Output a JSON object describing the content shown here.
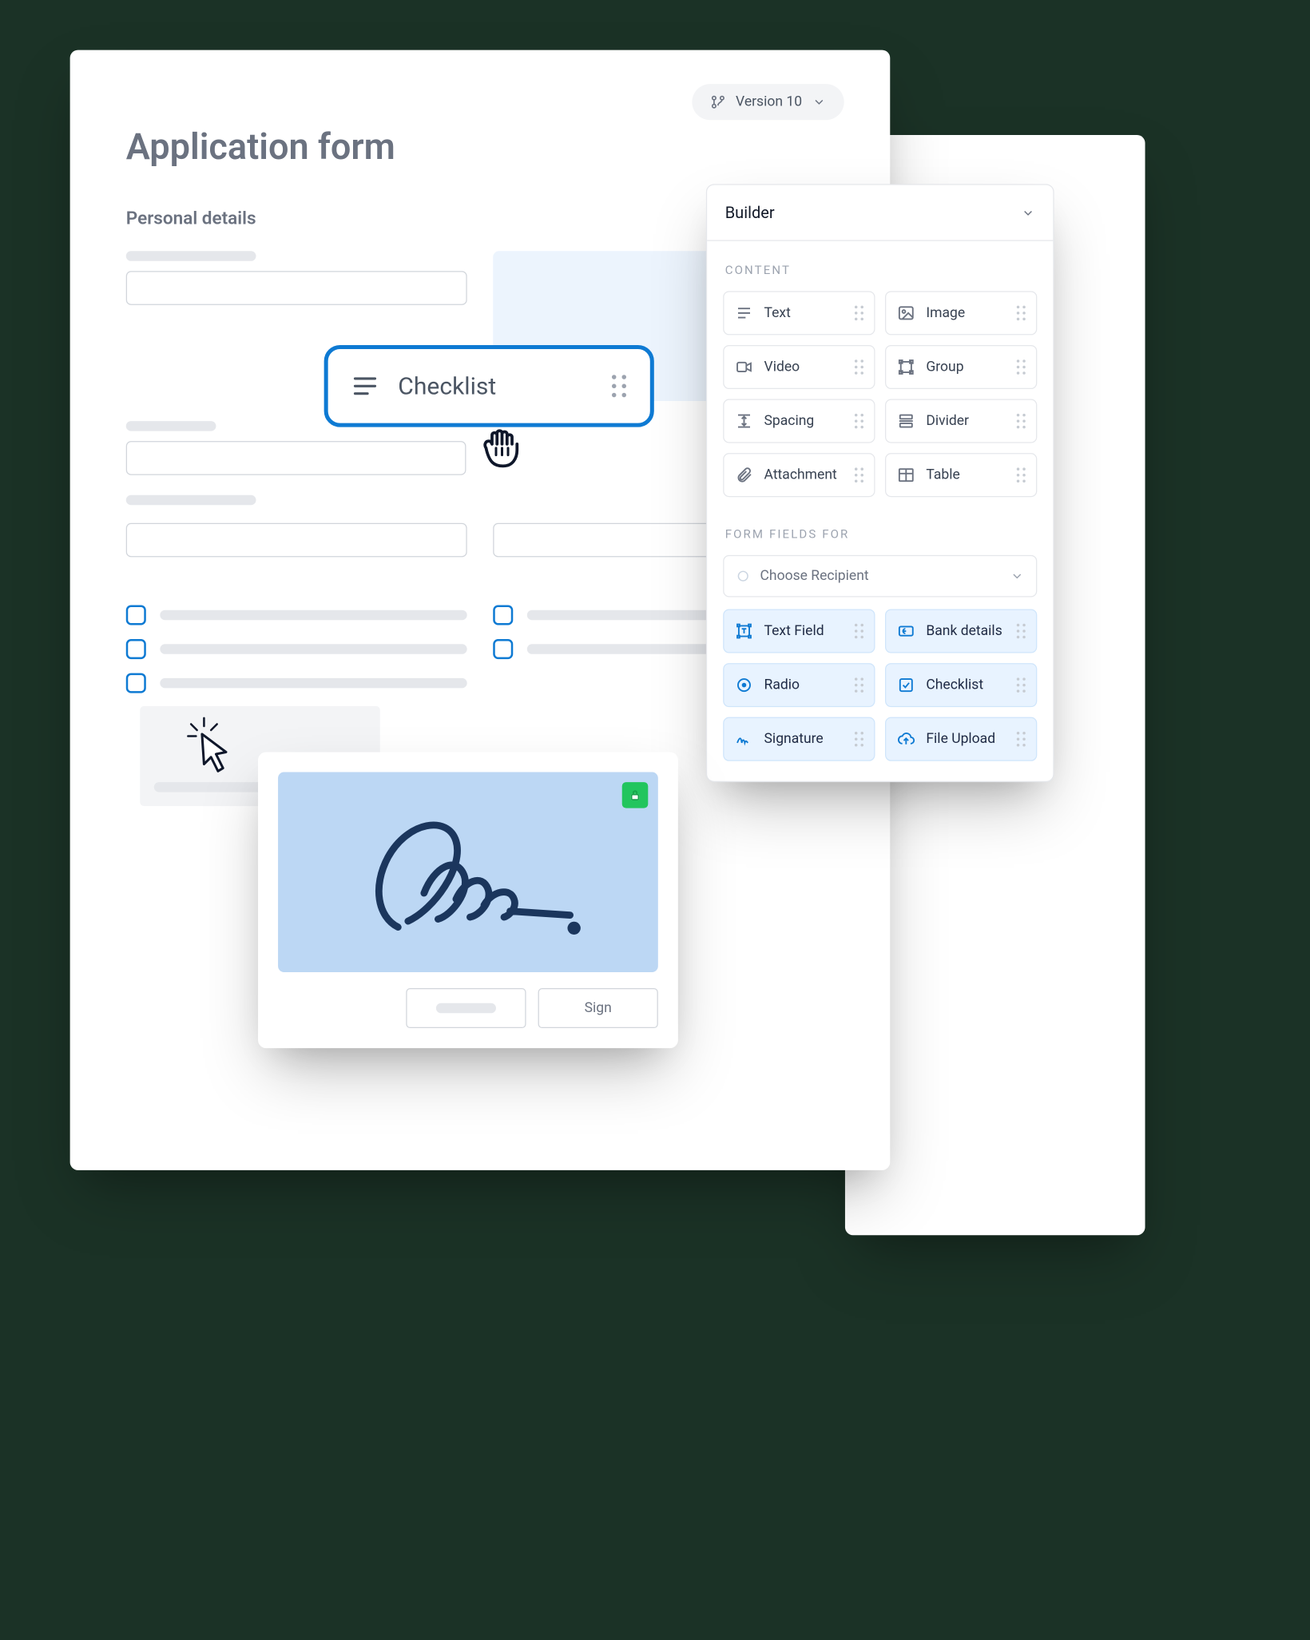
{
  "form": {
    "title": "Application form",
    "section_title": "Personal details"
  },
  "version": {
    "label": "Version 10"
  },
  "drag_chip": {
    "label": "Checklist"
  },
  "builder": {
    "title": "Builder",
    "sections": {
      "content_label": "CONTENT",
      "form_fields_label": "FORM FIELDS FOR"
    },
    "recipient": {
      "placeholder": "Choose Recipient"
    },
    "content_tiles": [
      {
        "label": "Text",
        "icon": "text"
      },
      {
        "label": "Image",
        "icon": "image"
      },
      {
        "label": "Video",
        "icon": "video"
      },
      {
        "label": "Group",
        "icon": "group"
      },
      {
        "label": "Spacing",
        "icon": "spacing"
      },
      {
        "label": "Divider",
        "icon": "divider"
      },
      {
        "label": "Attachment",
        "icon": "attachment"
      },
      {
        "label": "Table",
        "icon": "table"
      }
    ],
    "field_tiles": [
      {
        "label": "Text Field",
        "icon": "textfield"
      },
      {
        "label": "Bank details",
        "icon": "bank"
      },
      {
        "label": "Radio",
        "icon": "radio"
      },
      {
        "label": "Checklist",
        "icon": "check"
      },
      {
        "label": "Signature",
        "icon": "signature"
      },
      {
        "label": "File Upload",
        "icon": "upload"
      }
    ]
  },
  "signature": {
    "sign_label": "Sign"
  }
}
